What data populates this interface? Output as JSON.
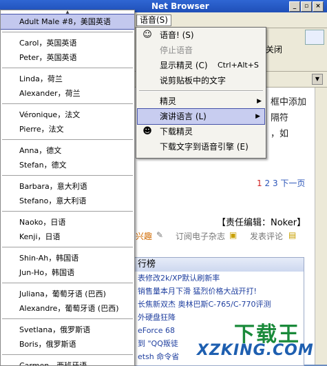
{
  "window": {
    "title": "Net Browser",
    "controls": [
      "_",
      "▫",
      "×"
    ]
  },
  "menubar": {
    "voice_menu_label": "语音(S)"
  },
  "toolbar": {
    "close_label": "关闭"
  },
  "voices": [
    {
      "group": 0,
      "label": "Adult Male #8，美国英语",
      "selected": true
    },
    {
      "group": 1,
      "label": "Carol，英国英语"
    },
    {
      "group": 1,
      "label": "Peter，英国英语"
    },
    {
      "group": 2,
      "label": "Linda，荷兰"
    },
    {
      "group": 2,
      "label": "Alexander，荷兰"
    },
    {
      "group": 3,
      "label": "Véronique，法文"
    },
    {
      "group": 3,
      "label": "Pierre，法文"
    },
    {
      "group": 4,
      "label": "Anna，德文"
    },
    {
      "group": 4,
      "label": "Stefan，德文"
    },
    {
      "group": 5,
      "label": "Barbara，意大利语"
    },
    {
      "group": 5,
      "label": "Stefano，意大利语"
    },
    {
      "group": 6,
      "label": "Naoko，日语"
    },
    {
      "group": 6,
      "label": "Kenji，日语"
    },
    {
      "group": 7,
      "label": "Shin-Ah，韩国语"
    },
    {
      "group": 7,
      "label": "Jun-Ho，韩国语"
    },
    {
      "group": 8,
      "label": "Juliana，葡萄牙语 (巴西)"
    },
    {
      "group": 8,
      "label": "Alexandre，葡萄牙语 (巴西)"
    },
    {
      "group": 9,
      "label": "Svetlana，俄罗斯语"
    },
    {
      "group": 9,
      "label": "Boris，俄罗斯语"
    },
    {
      "group": 10,
      "label": "Carmen，西班牙语"
    }
  ],
  "context_menu": {
    "items": [
      {
        "label": "语音! (S)",
        "icon": "speaker-face-icon",
        "glyph": "☺"
      },
      {
        "label": "停止语音",
        "disabled": true
      },
      {
        "label": "显示精灵 (C)",
        "shortcut": "Ctrl+Alt+S"
      },
      {
        "label": "说剪贴板中的文字"
      },
      {
        "sep": true
      },
      {
        "label": "精灵",
        "submenu": true
      },
      {
        "label": "演讲语言 (L)",
        "submenu": true,
        "selected": true
      },
      {
        "label": "下载精灵",
        "icon": "agent-download-icon",
        "glyph": "☻"
      },
      {
        "label": "下载文字到语音引擎 (E)"
      }
    ]
  },
  "content": {
    "fragments": [
      "框中添加",
      "隔符",
      "，如"
    ],
    "pager": {
      "pages": [
        "1",
        "2",
        "3"
      ],
      "current": "1",
      "next": "下一页"
    },
    "editor": "【责任编辑：Noker】",
    "actions": [
      "兴趣",
      "订阅电子杂志",
      "发表评论"
    ],
    "rank_title": "行榜",
    "rank_items": [
      "表修改2k/XP默认刷新率",
      "销售量本月下滑 猛烈价格大战开打!",
      "长焦新双杰  奥林巴斯C-765/C-770评测",
      "外硬盘狂降",
      "eForce 68",
      "到 \"QQ叛徒",
      "etsh 命令省"
    ]
  },
  "watermark": {
    "title": "下载王",
    "url": "XZKING.COM"
  },
  "colors": {
    "title_bar": "#1f4fb8",
    "selection": "#c3c8ee",
    "link": "#1f3f9f",
    "watermark_green": "#1a8a3a",
    "watermark_blue": "#1e5fb0"
  }
}
